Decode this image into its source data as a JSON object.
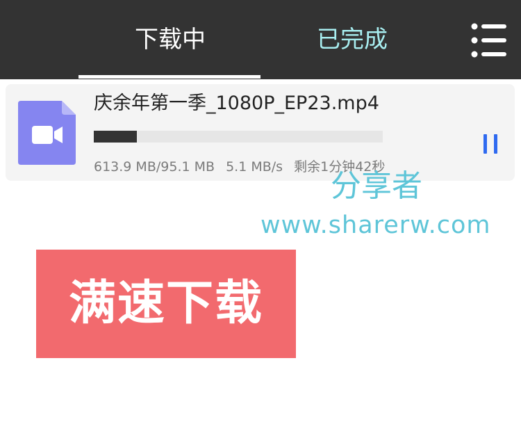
{
  "tabs": {
    "downloading": "下载中",
    "completed": "已完成"
  },
  "menu": {
    "icon": "menu-icon"
  },
  "download": {
    "file_name": "庆余年第一季_1080P_EP23.mp4",
    "progress_fraction": 0.15,
    "size_info": "613.9 MB/95.1 MB",
    "speed": "5.1 MB/s",
    "remaining": "剩余1分钟42秒",
    "file_icon": "video-file-icon",
    "pause_icon": "pause-icon",
    "accent_color": "#2f6af0",
    "icon_color": "#8585f0"
  },
  "watermark": {
    "name": "分享者",
    "url": "www.sharerw.com"
  },
  "promo": {
    "label": "满速下载"
  },
  "colors": {
    "topbar": "#333333",
    "completed_tab": "#a8eef0",
    "promo_bg": "#f26a6e",
    "watermark": "#5ec5d8"
  }
}
